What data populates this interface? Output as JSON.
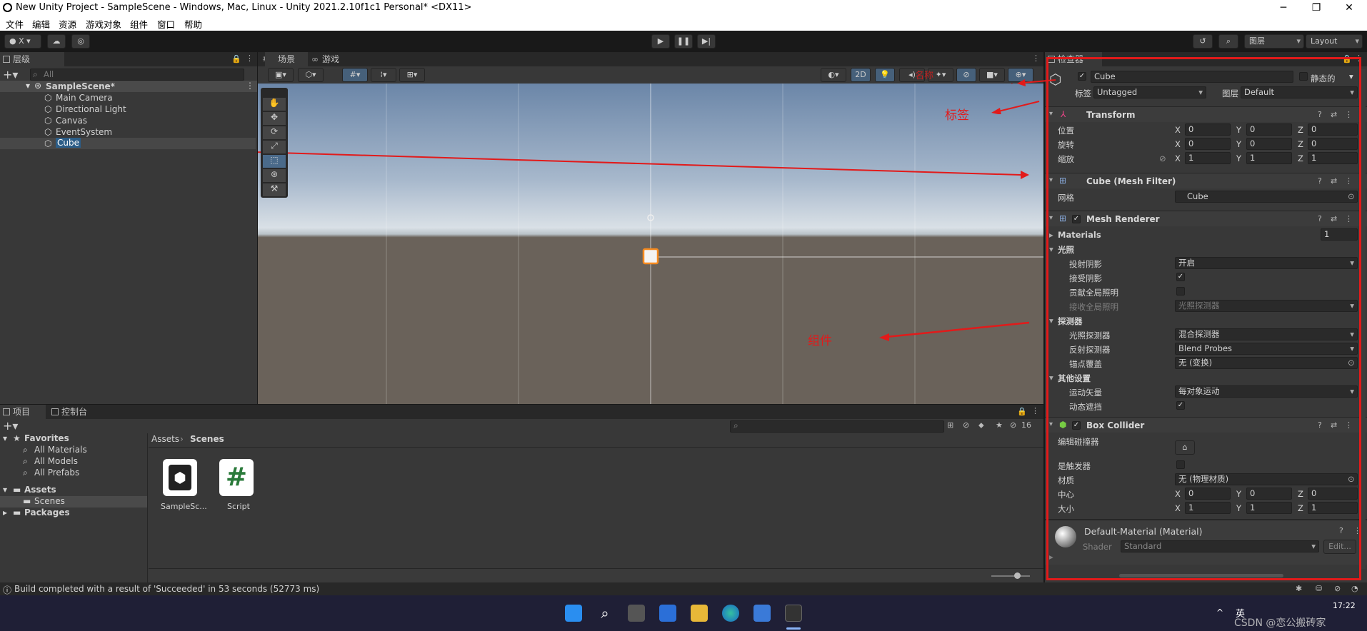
{
  "window": {
    "title": "New Unity Project - SampleScene - Windows, Mac, Linux - Unity 2021.2.10f1c1 Personal* <DX11>",
    "min": "─",
    "max": "❐",
    "close": "✕"
  },
  "menu": [
    "文件",
    "编辑",
    "资源",
    "游戏对象",
    "组件",
    "窗口",
    "帮助"
  ],
  "toolbar": {
    "account_label": "X",
    "layers_label": "图层",
    "layout_label": "Layout"
  },
  "hierarchy": {
    "tab": "层级",
    "search_placeholder": "All",
    "scene": "SampleScene*",
    "items": [
      "Main Camera",
      "Directional Light",
      "Canvas",
      "EventSystem",
      "Cube"
    ]
  },
  "scene_view": {
    "tabs": [
      "场景",
      "游戏"
    ],
    "mode_2d": "2D"
  },
  "project": {
    "tabs": [
      "项目",
      "控制台"
    ],
    "favorites_label": "Favorites",
    "favorites": [
      "All Materials",
      "All Models",
      "All Prefabs"
    ],
    "assets_label": "Assets",
    "assets_children": [
      "Scenes"
    ],
    "packages_label": "Packages",
    "breadcrumb": [
      "Assets",
      "Scenes"
    ],
    "files": [
      {
        "name": "SampleSc...",
        "icon": "unity-scene-icon"
      },
      {
        "name": "Script",
        "icon": "csharp-script-icon"
      }
    ],
    "hidden_count": "16"
  },
  "inspector": {
    "tab": "检查器",
    "object_name": "Cube",
    "static_label": "静态的",
    "tag_label": "标签",
    "tag_value": "Untagged",
    "layer_label": "图层",
    "layer_value": "Default",
    "transform": {
      "title": "Transform",
      "position_label": "位置",
      "rotation_label": "旋转",
      "scale_label": "缩放",
      "position": [
        "0",
        "0",
        "0"
      ],
      "rotation": [
        "0",
        "0",
        "0"
      ],
      "scale": [
        "1",
        "1",
        "1"
      ]
    },
    "mesh_filter": {
      "title": "Cube (Mesh Filter)",
      "mesh_label": "网格",
      "mesh_value": "Cube"
    },
    "mesh_renderer": {
      "title": "Mesh Renderer",
      "materials_label": "Materials",
      "materials_count": "1",
      "lighting_label": "光照",
      "cast_shadows_label": "投射阴影",
      "cast_shadows_value": "开启",
      "receive_shadows_label": "接受阴影",
      "contribute_gi_label": "贡献全局照明",
      "receive_gi_label": "接收全局照明",
      "receive_gi_value": "光照探测器",
      "probes_label": "探测器",
      "light_probes_label": "光照探测器",
      "light_probes_value": "混合探测器",
      "reflection_probes_label": "反射探测器",
      "reflection_probes_value": "Blend Probes",
      "anchor_override_label": "锚点覆盖",
      "anchor_override_value": "无 (变换)",
      "other_label": "其他设置",
      "motion_vectors_label": "运动矢量",
      "motion_vectors_value": "每对象运动",
      "dynamic_occlusion_label": "动态遮挡"
    },
    "box_collider": {
      "title": "Box Collider",
      "edit_label": "编辑碰撞器",
      "is_trigger_label": "是触发器",
      "material_label": "材质",
      "material_value": "无 (物理材质)",
      "center_label": "中心",
      "size_label": "大小",
      "center": [
        "0",
        "0",
        "0"
      ],
      "size": [
        "1",
        "1",
        "1"
      ]
    },
    "material": {
      "name": "Default-Material (Material)",
      "shader_label": "Shader",
      "shader_value": "Standard",
      "edit_label": "Edit..."
    }
  },
  "annotations": {
    "component": "组件",
    "tag": "标签",
    "overlay_text": "名称"
  },
  "status": {
    "message": "Build completed with a result of 'Succeeded' in 53 seconds (52773 ms)"
  },
  "taskbar": {
    "ime": "英",
    "time": "17:22",
    "watermark": "CSDN @恋公搬砖家"
  },
  "colors": {
    "editor_bg": "#383838",
    "dark_bg": "#282828",
    "selection": "#2c5d87",
    "annotation_red": "#e21a1a"
  }
}
